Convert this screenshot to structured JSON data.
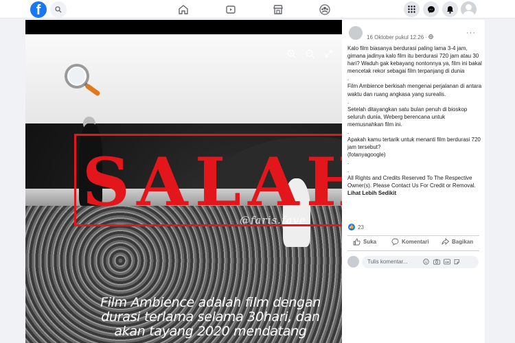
{
  "topbar": {
    "logo_letter": "f",
    "nav": [
      "home-icon",
      "watch-icon",
      "marketplace-icon",
      "groups-icon"
    ],
    "right": [
      "menu-grid-icon",
      "messenger-icon",
      "notifications-icon",
      "account-avatar"
    ]
  },
  "media": {
    "stamp_text": "SALAH",
    "watermark": "@faris.fave",
    "caption": "Film Ambience adalah film dengan durasi terlama selama 30hari, dan akan tayang 2020 mendatang"
  },
  "post": {
    "meta": "16 Oktober pukul 12.26 · ",
    "more": "···",
    "paragraphs": [
      "Kalo film biasanya berdurasi paling lama 3-4 jam, gimana jadinya kalo film itu berdurasi 720 jam atau 30 hari? Waduh gak kebayang nontonnya ya, film ini bakal mencetak rekor sebagai film terpanjang di dunia",
      ".",
      "Film Ambience berkisah mengenai perjalanan di antara waktu dan ruang angkasa yang surealis.",
      ".",
      "Setelah ditayangkan satu bulan penuh di bioskop seluruh dunia, Weberg berencana untuk memusnahkan film ini.",
      ".",
      "Apakah kamu tertarik untuk menanti film berdurasi 720 jam tersebut?",
      "(fotanyagoogle)",
      ".",
      ".",
      "All Rights and Credits Reserved To The Respective Owner(s). Please Contact Us For Credit or Removal."
    ],
    "see_more": "Lihat Lebih Sedikit",
    "reaction_count": "23",
    "actions": {
      "like": "Suka",
      "comment": "Komentari",
      "share": "Bagikan"
    },
    "comment_placeholder": "Tulis komentar..."
  }
}
